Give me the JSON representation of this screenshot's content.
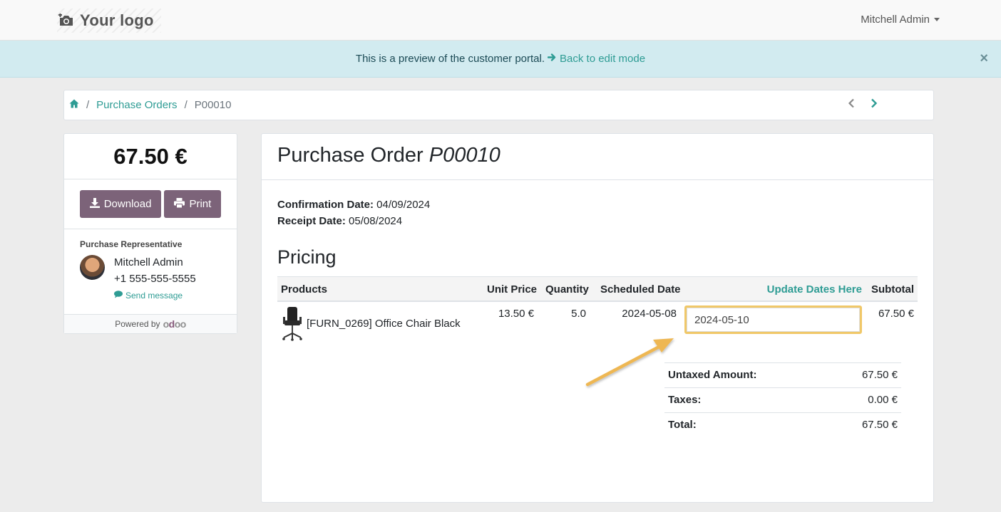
{
  "header": {
    "logo_text": "Your logo",
    "user_name": "Mitchell Admin"
  },
  "alert": {
    "message": "This is a preview of the customer portal.",
    "link_text": "Back to edit mode"
  },
  "breadcrumb": {
    "section": "Purchase Orders",
    "current": "P00010"
  },
  "sidebar": {
    "total": "67.50 €",
    "download_label": "Download",
    "print_label": "Print",
    "rep_title": "Purchase Representative",
    "rep_name": "Mitchell Admin",
    "rep_phone": "+1 555-555-5555",
    "send_message": "Send message",
    "powered_by": "Powered by",
    "odoo": "odoo"
  },
  "order": {
    "title_prefix": "Purchase Order",
    "number": "P00010",
    "confirmation_label": "Confirmation Date:",
    "confirmation_value": "04/09/2024",
    "receipt_label": "Receipt Date:",
    "receipt_value": "05/08/2024",
    "section_title": "Pricing"
  },
  "table": {
    "headers": {
      "products": "Products",
      "unit_price": "Unit Price",
      "quantity": "Quantity",
      "scheduled_date": "Scheduled Date",
      "update_dates": "Update Dates Here",
      "subtotal": "Subtotal"
    },
    "rows": [
      {
        "product": "[FURN_0269] Office Chair Black",
        "unit_price": "13.50 €",
        "quantity": "5.0",
        "scheduled_date": "2024-05-08",
        "new_date": "2024-05-10",
        "subtotal": "67.50 €"
      }
    ]
  },
  "totals": {
    "untaxed_label": "Untaxed Amount:",
    "untaxed_value": "67.50 €",
    "taxes_label": "Taxes:",
    "taxes_value": "0.00 €",
    "total_label": "Total:",
    "total_value": "67.50 €"
  },
  "colors": {
    "accent": "#2e9c94",
    "button": "#7c6379",
    "highlight": "#f0c869",
    "alert_bg": "#d2ebf0"
  }
}
